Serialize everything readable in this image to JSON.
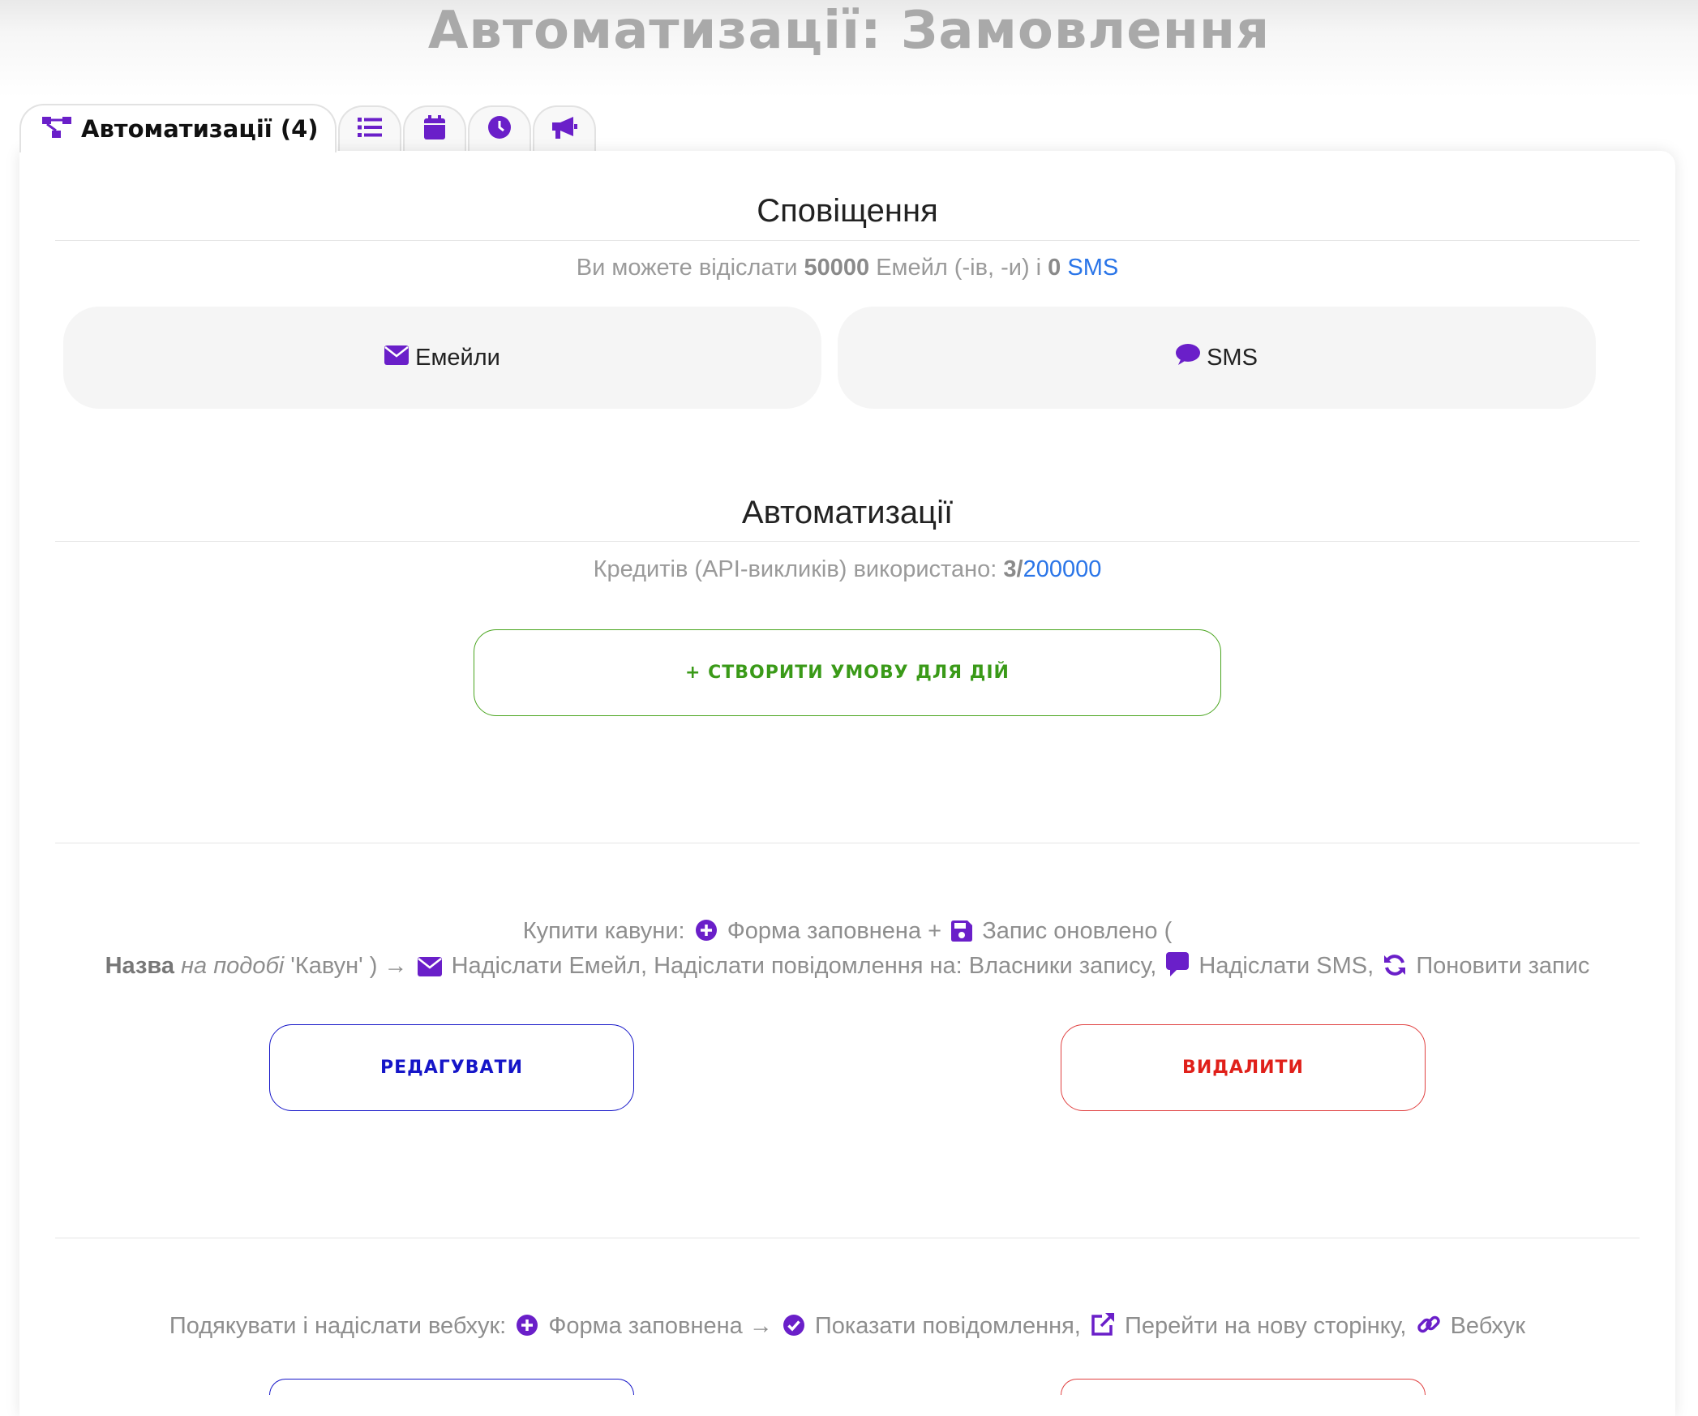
{
  "page_title": "Автоматизації: Замовлення",
  "tabs": {
    "active_label": "Автоматизації (4)",
    "icons": [
      "sitemap-icon",
      "list-icon",
      "calendar-icon",
      "clock-icon",
      "bullhorn-icon"
    ]
  },
  "notifications": {
    "title": "Сповіщення",
    "info_prefix": "Ви можете відіслати",
    "email_count": "50000",
    "info_mid": "Емейл (-ів, -и) і",
    "sms_count": "0",
    "sms_link": "SMS",
    "emails_button": "Емейли",
    "sms_button": "SMS"
  },
  "automations": {
    "title": "Автоматизації",
    "credits_label": "Кредитів (API-викликів) використано:",
    "credits_used": "3/",
    "credits_total": "200000",
    "create_button": "+ СТВОРИТИ УМОВУ ДЛЯ ДІЙ"
  },
  "rules": [
    {
      "name": "Купити кавуни:",
      "trigger1": "Форма заповнена +",
      "trigger2": "Запис оновлено (",
      "cond_field": "Назва",
      "cond_op": "на подобі",
      "cond_value": "'Кавун' ) →",
      "action1": "Надіслати Емейл,  Надіслати повідомлення на: Власники запису,",
      "action2": "Надіслати SMS,",
      "action3": "Поновити запис",
      "edit_button": "РЕДАГУВАТИ",
      "delete_button": "ВИДАЛИТИ"
    },
    {
      "name": "Подякувати і надіслати вебхук:",
      "trigger1": "Форма заповнена →",
      "action1": "Показати повідомлення,",
      "action2": "Перейти на нову сторінку,",
      "action3": "Вебхук"
    }
  ],
  "colors": {
    "accent_purple": "#6a1fc9",
    "link_blue": "#2a75e8",
    "create_green": "#3a9a18",
    "edit_blue": "#1515c8",
    "delete_red": "#e0201a"
  }
}
